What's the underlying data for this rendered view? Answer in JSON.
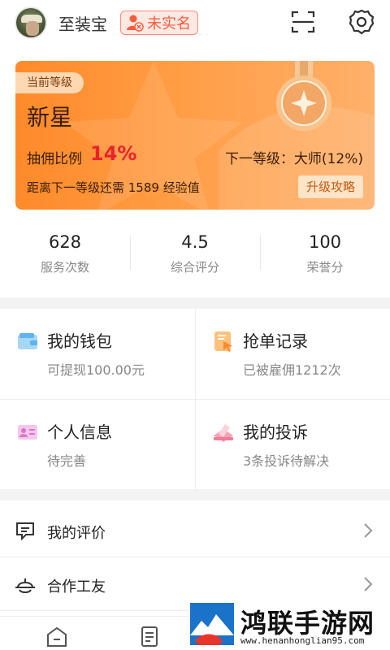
{
  "header": {
    "username": "至装宝",
    "verify_badge": "未实名",
    "icons": [
      "scan-icon",
      "gear-icon"
    ]
  },
  "level_card": {
    "tag": "当前等级",
    "level_name": "新星",
    "commission_label": "抽佣比例",
    "commission_value": "14%",
    "next_level": "下一等级：大师(12%)",
    "exp_text": "距离下一等级还需 1589 经验值",
    "upgrade_button": "升级攻略"
  },
  "stats": [
    {
      "value": "628",
      "label": "服务次数"
    },
    {
      "value": "4.5",
      "label": "综合评分"
    },
    {
      "value": "100",
      "label": "荣誉分"
    }
  ],
  "grid": [
    {
      "title": "我的钱包",
      "subtitle": "可提现100.00元",
      "icon": "wallet-icon"
    },
    {
      "title": "抢单记录",
      "subtitle": "已被雇佣1212次",
      "icon": "order-record-icon"
    },
    {
      "title": "个人信息",
      "subtitle": "待完善",
      "icon": "id-card-icon"
    },
    {
      "title": "我的投诉",
      "subtitle": "3条投诉待解决",
      "icon": "complaint-icon"
    }
  ],
  "list": [
    {
      "label": "我的评价",
      "icon": "comment-icon"
    },
    {
      "label": "合作工友",
      "icon": "helmet-icon"
    }
  ],
  "watermark": {
    "title": "鸿联手游网",
    "url": "www.henanhonglian95.com"
  },
  "colors": {
    "accent_orange": "#ff8a2a",
    "commission_red": "#e8232d",
    "badge_red": "#ff5a3c"
  }
}
